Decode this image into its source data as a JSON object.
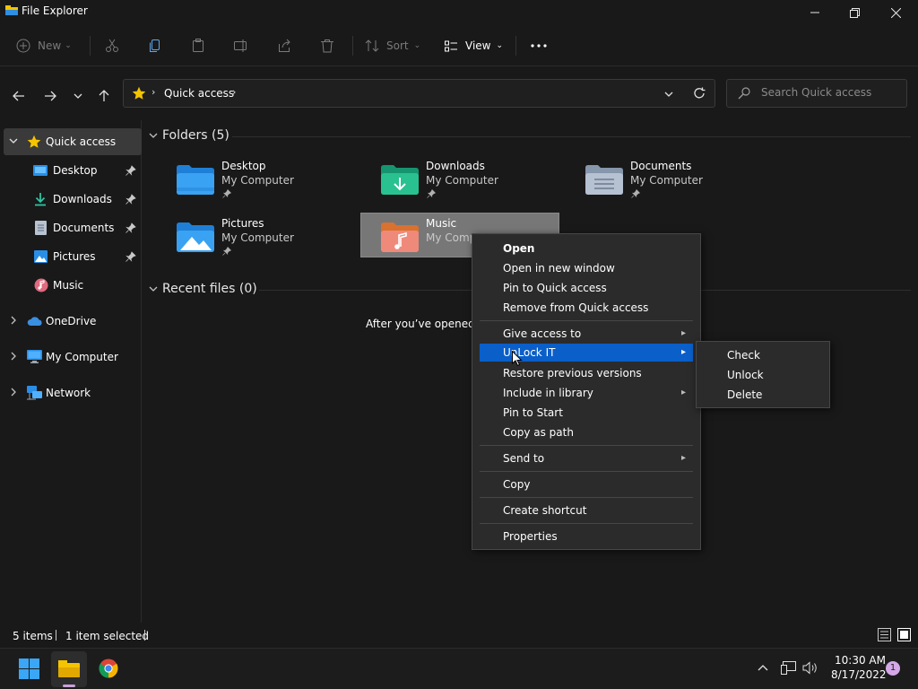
{
  "window": {
    "title": "File Explorer"
  },
  "toolbar": {
    "new_label": "New",
    "sort_label": "Sort",
    "view_label": "View",
    "icons": [
      "cut-icon",
      "copy-icon",
      "paste-icon",
      "rename-icon",
      "share-icon",
      "delete-icon",
      "more-icon"
    ]
  },
  "address": {
    "crumb": "Quick access",
    "search_placeholder": "Search Quick access"
  },
  "sidebar": {
    "items": [
      {
        "label": "Quick access",
        "icon": "star-icon",
        "expanded": true,
        "selected": true
      },
      {
        "label": "Desktop",
        "icon": "desktop-folder-icon",
        "pinned": true
      },
      {
        "label": "Downloads",
        "icon": "download-icon",
        "pinned": true
      },
      {
        "label": "Documents",
        "icon": "documents-icon",
        "pinned": true
      },
      {
        "label": "Pictures",
        "icon": "pictures-icon",
        "pinned": true
      },
      {
        "label": "Music",
        "icon": "music-icon"
      },
      {
        "label": "OneDrive",
        "icon": "cloud-icon"
      },
      {
        "label": "My Computer",
        "icon": "computer-icon"
      },
      {
        "label": "Network",
        "icon": "network-icon"
      }
    ]
  },
  "main": {
    "folders_header": "Folders (5)",
    "recent_header": "Recent files (0)",
    "recent_empty_text": "After you’ve opened so",
    "folders": [
      {
        "name": "Desktop",
        "location": "My Computer",
        "pinned": true,
        "icon": "desktop-folder-icon"
      },
      {
        "name": "Downloads",
        "location": "My Computer",
        "pinned": true,
        "icon": "downloads-folder-icon"
      },
      {
        "name": "Documents",
        "location": "My Computer",
        "pinned": true,
        "icon": "documents-folder-icon"
      },
      {
        "name": "Pictures",
        "location": "My Computer",
        "pinned": true,
        "icon": "pictures-folder-icon"
      },
      {
        "name": "Music",
        "location": "My Comput",
        "pinned": false,
        "selected": true,
        "icon": "music-folder-icon"
      }
    ]
  },
  "context_menu": {
    "items": [
      {
        "label": "Open",
        "bold": true
      },
      {
        "label": "Open in new window"
      },
      {
        "label": "Pin to Quick access"
      },
      {
        "label": "Remove from Quick access"
      },
      {
        "label": "Give access to",
        "submenu": true
      },
      {
        "label": "UnLock IT",
        "submenu": true,
        "highlighted": true
      },
      {
        "label": "Restore previous versions"
      },
      {
        "label": "Include in library",
        "submenu": true
      },
      {
        "label": "Pin to Start"
      },
      {
        "label": "Copy as path"
      },
      {
        "label": "Send to",
        "submenu": true
      },
      {
        "label": "Copy"
      },
      {
        "label": "Create shortcut"
      },
      {
        "label": "Properties"
      }
    ],
    "submenu_items": [
      "Check",
      "Unlock",
      "Delete"
    ]
  },
  "status": {
    "item_count": "5 items",
    "selection": "1 item selected"
  },
  "taskbar": {
    "time": "10:30 AM",
    "date": "8/17/2022",
    "notification_count": "1"
  },
  "colors": {
    "accent": "#0a5fc9",
    "background": "#191919",
    "menu_bg": "#2b2b2b",
    "star": "#f5c400"
  }
}
